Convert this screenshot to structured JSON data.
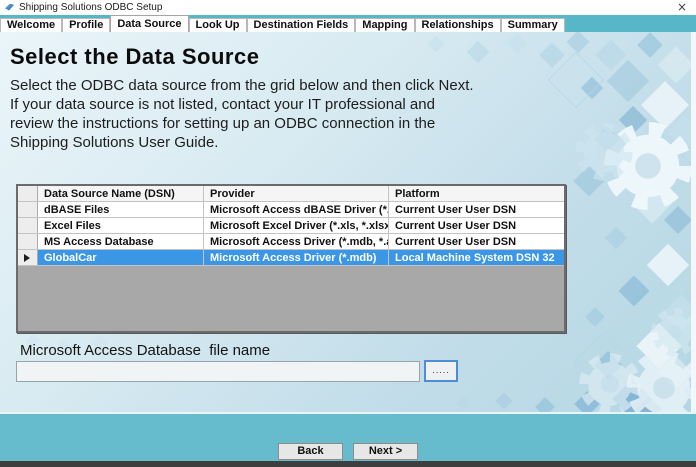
{
  "window": {
    "title": "Shipping Solutions ODBC Setup",
    "close_label": "×"
  },
  "tabs": [
    "Welcome",
    "Profile",
    "Data Source",
    "Look Up",
    "Destination Fields",
    "Mapping",
    "Relationships",
    "Summary"
  ],
  "active_tab": "Data Source",
  "page": {
    "heading": "Select the Data Source",
    "description_lines": [
      "Select the ODBC data source from the grid below and then click Next.",
      "If your data source is not listed, contact your IT professional and",
      "review the instructions for setting up an ODBC connection in the",
      "Shipping Solutions User Guide."
    ]
  },
  "grid": {
    "columns": [
      "Data Source Name (DSN)",
      "Provider",
      "Platform"
    ],
    "rows": [
      {
        "dsn": "dBASE Files",
        "provider": "Microsoft Access dBASE Driver (*.dbf...",
        "platform": "Current User User DSN",
        "selected": false
      },
      {
        "dsn": "Excel Files",
        "provider": "Microsoft Excel Driver (*.xls, *.xlsx, *...",
        "platform": "Current User User DSN",
        "selected": false
      },
      {
        "dsn": "MS Access Database",
        "provider": "Microsoft Access Driver (*.mdb, *.acc...",
        "platform": "Current User User DSN",
        "selected": false
      },
      {
        "dsn": "GlobalCar",
        "provider": "Microsoft Access Driver (*.mdb)",
        "platform": "Local Machine System DSN 32",
        "selected": true
      }
    ]
  },
  "file_section": {
    "label": "Microsoft Access Database  file name",
    "value": "",
    "browse_label": "....."
  },
  "footer": {
    "back_label": "Back",
    "next_label": "Next >"
  },
  "colors": {
    "accent_teal": "#57b6c8",
    "selection_blue": "#3b96e6",
    "grid_empty_gray": "#a8a8a8"
  }
}
